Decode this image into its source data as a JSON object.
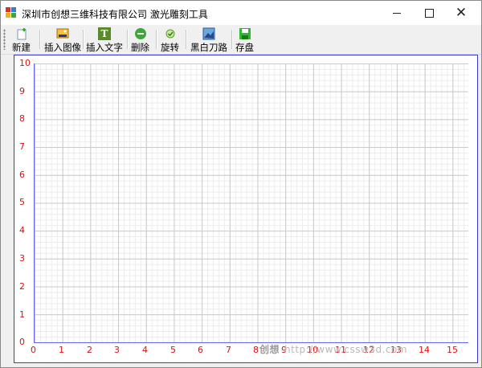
{
  "window": {
    "title": "深圳市创想三维科技有限公司 激光雕刻工具"
  },
  "toolbar": {
    "buttons": [
      {
        "label": "新建",
        "icon": "new-icon"
      },
      {
        "label": "插入图像",
        "icon": "insert-image-icon"
      },
      {
        "label": "插入文字",
        "icon": "insert-text-icon"
      },
      {
        "label": "删除",
        "icon": "delete-icon"
      },
      {
        "label": "旋转",
        "icon": "rotate-icon"
      },
      {
        "label": "黑白刀路",
        "icon": "bw-toolpath-icon"
      },
      {
        "label": "存盘",
        "icon": "save-icon"
      }
    ],
    "text_icon_glyph": "T"
  },
  "canvas": {
    "y_ticks": [
      "10",
      "9",
      "8",
      "7",
      "6",
      "5",
      "4",
      "3",
      "2",
      "1",
      "0"
    ],
    "x_ticks": [
      "0",
      "1",
      "2",
      "3",
      "4",
      "5",
      "6",
      "7",
      "8",
      "9",
      "10",
      "11",
      "12",
      "13",
      "14",
      "15"
    ],
    "tick_color": "#e01010",
    "axis_color": "#6666ff"
  },
  "watermark": {
    "logo": "创想",
    "text": "http://www.cssw3d.com"
  },
  "window_controls": {
    "minimize": "minimize-icon",
    "maximize": "maximize-icon",
    "close_glyph": "✕"
  }
}
